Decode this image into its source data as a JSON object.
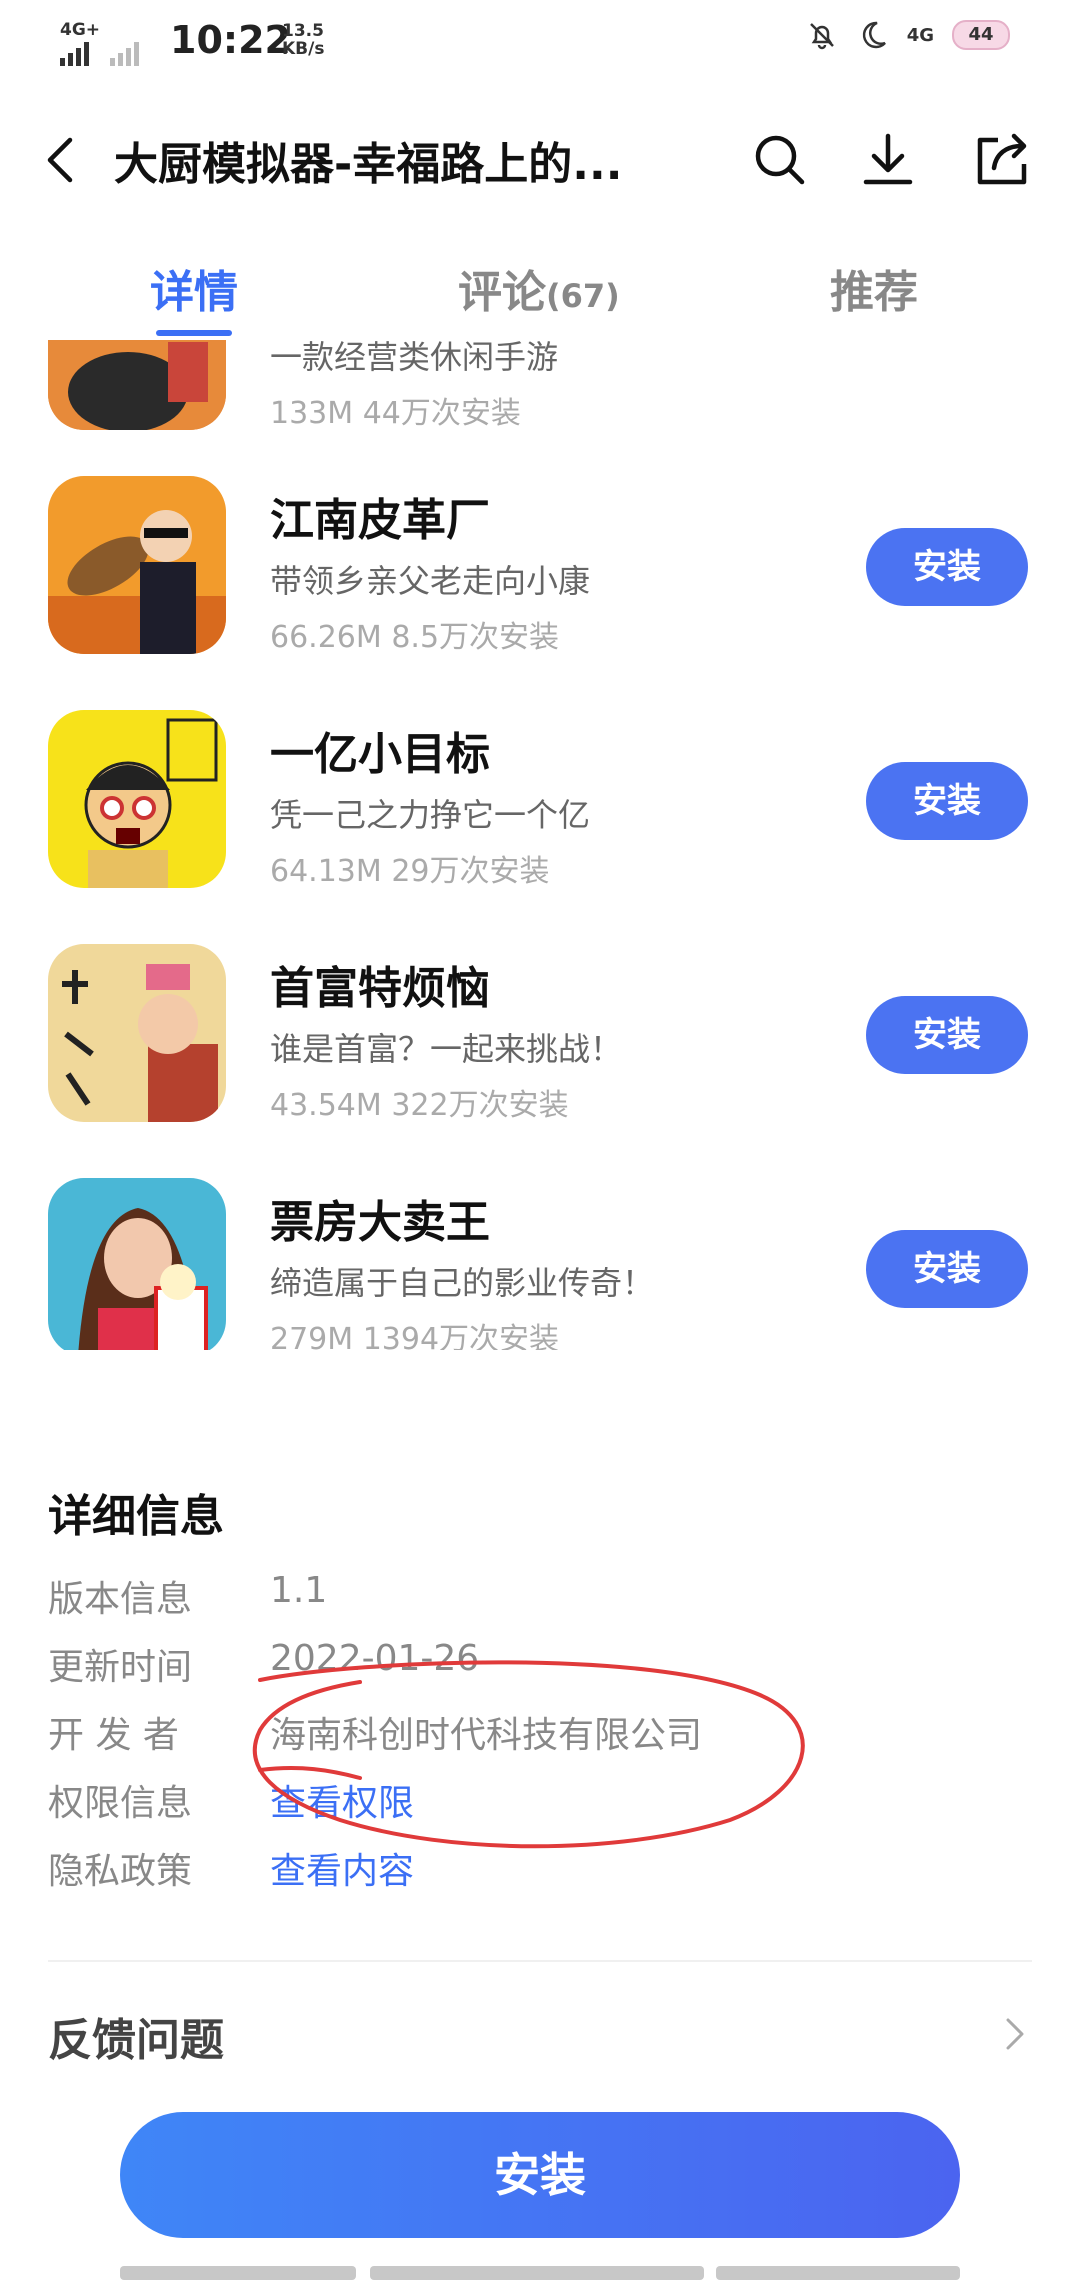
{
  "status_bar": {
    "network": "4G+",
    "time": "10:22",
    "speed_value": "13.5",
    "speed_unit": "KB/s",
    "network_right": "4G",
    "battery": "44"
  },
  "header": {
    "title": "大厨模拟器-幸福路上的...",
    "icons": [
      "back-arrow-icon",
      "search-icon",
      "download-icon",
      "share-icon"
    ]
  },
  "tabs": [
    {
      "label": "详情",
      "active": true
    },
    {
      "label": "评论",
      "count": "(67)",
      "active": false
    },
    {
      "label": "推荐",
      "active": false
    }
  ],
  "apps": [
    {
      "name": "",
      "desc": "一款经营类休闲手游",
      "size": "133M",
      "installs": "44万次安装",
      "button": "安装",
      "thumb_bg": "#e78a3a"
    },
    {
      "name": "江南皮革厂",
      "desc": "带领乡亲父老走向小康",
      "size": "66.26M",
      "installs": "8.5万次安装",
      "button": "安装",
      "thumb_bg": "#f29b2c"
    },
    {
      "name": "一亿小目标",
      "desc": "凭一己之力挣它一个亿",
      "size": "64.13M",
      "installs": "29万次安装",
      "button": "安装",
      "thumb_bg": "#f7e21a"
    },
    {
      "name": "首富特烦恼",
      "desc": "谁是首富？一起来挑战！",
      "size": "43.54M",
      "installs": "322万次安装",
      "button": "安装",
      "thumb_bg": "#f0d89a"
    },
    {
      "name": "票房大卖王",
      "desc": "缔造属于自己的影业传奇！",
      "size": "279M",
      "installs": "1394万次安装",
      "button": "安装",
      "thumb_bg": "#4ab7d6"
    }
  ],
  "details": {
    "title": "详细信息",
    "rows": [
      {
        "label": "版本信息",
        "value": "1.1",
        "link": false
      },
      {
        "label": "更新时间",
        "value": "2022-01-26",
        "link": false
      },
      {
        "label": "开 发 者",
        "value": "海南科创时代科技有限公司",
        "link": false
      },
      {
        "label": "权限信息",
        "value": "查看权限",
        "link": true
      },
      {
        "label": "隐私政策",
        "value": "查看内容",
        "link": true
      }
    ]
  },
  "feedback": {
    "label": "反馈问题"
  },
  "install_button": "安装",
  "colors": {
    "accent": "#3b6ff5",
    "button": "#4b73f2",
    "annotation": "#e03a3a"
  }
}
